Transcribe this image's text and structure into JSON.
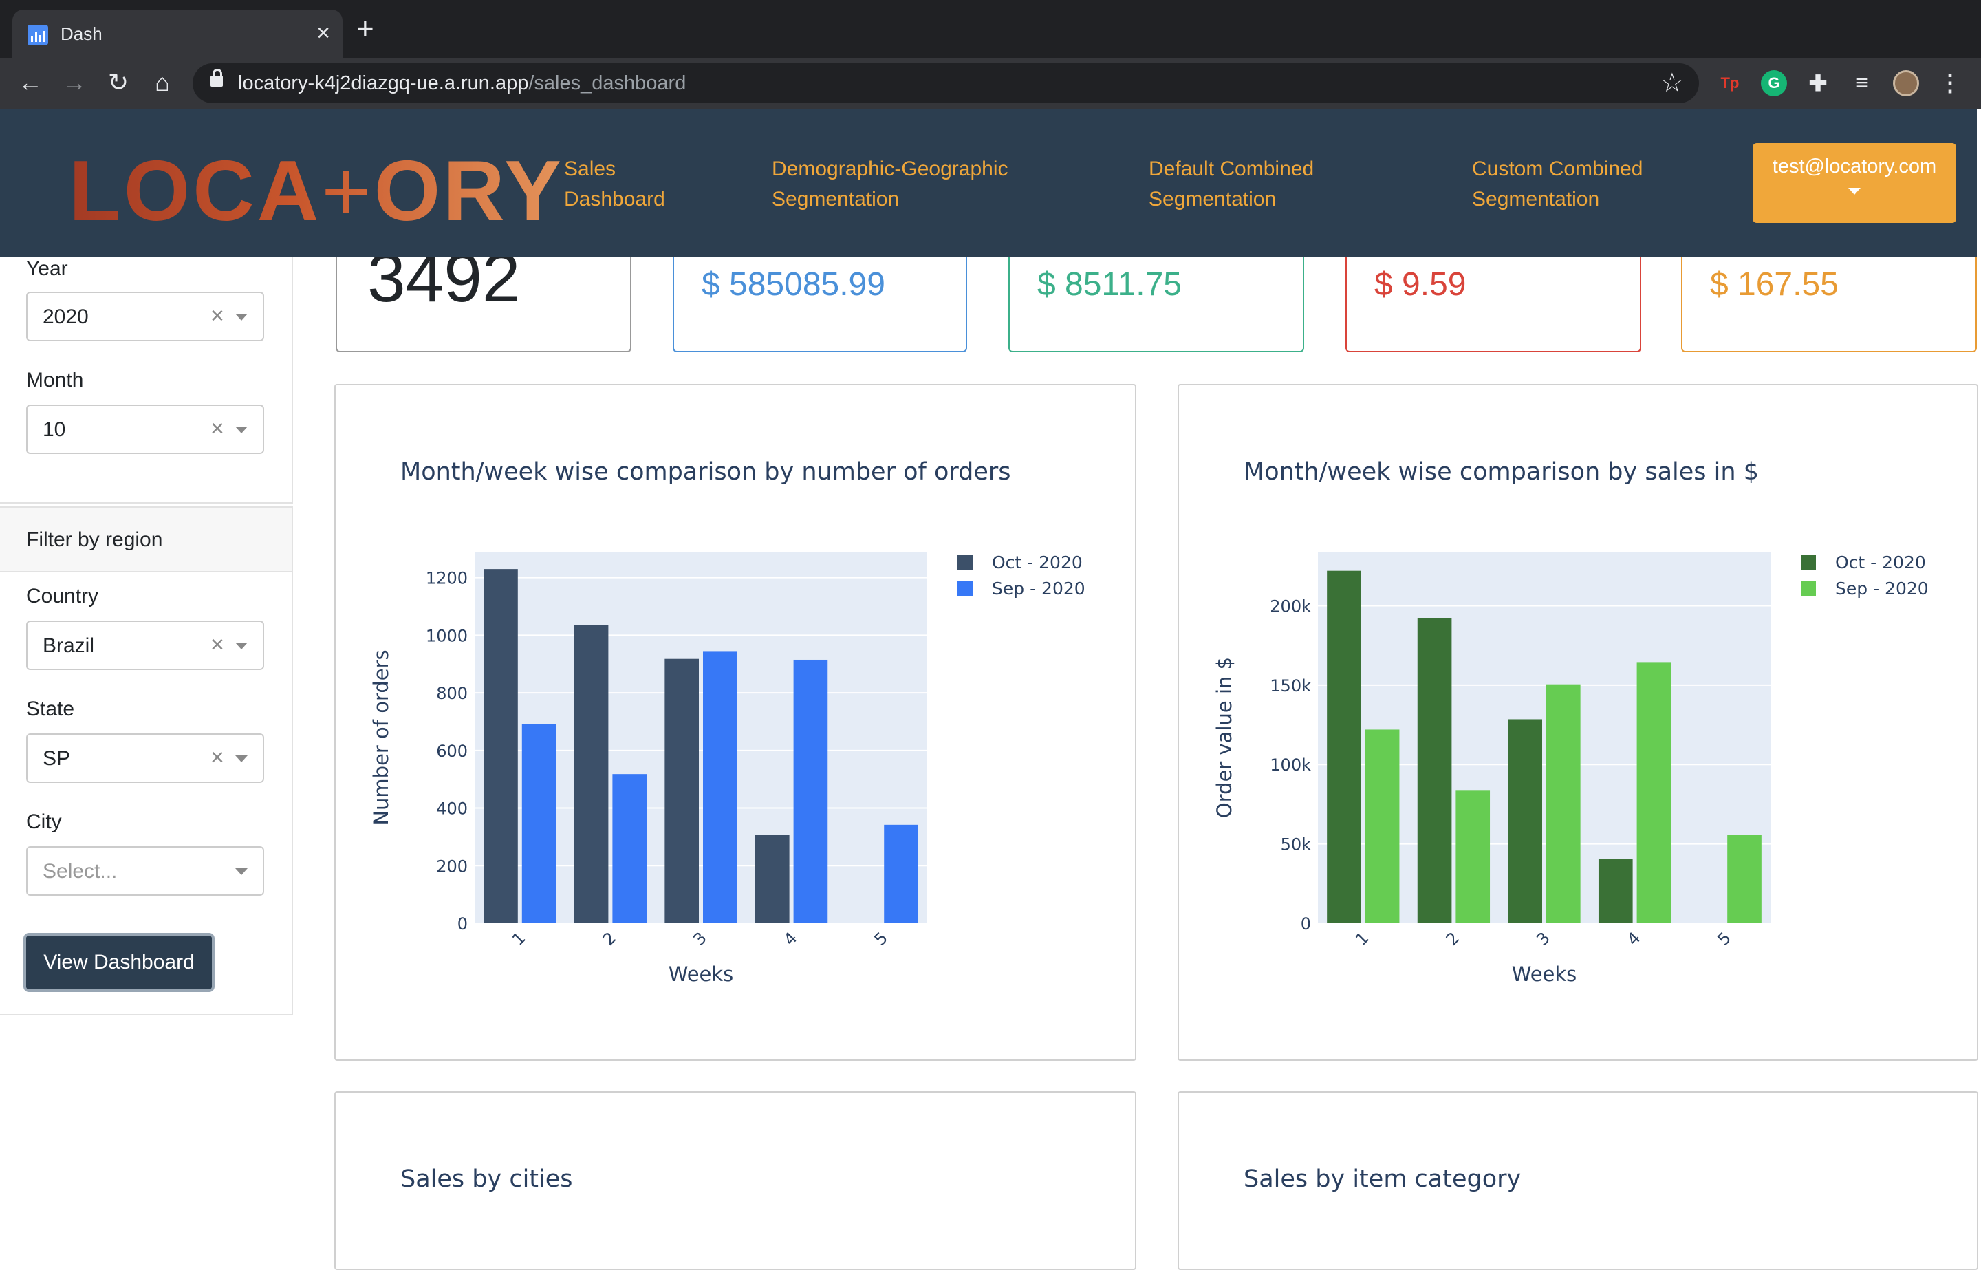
{
  "browser": {
    "tab_title": "Dash",
    "url_host": "locatory-k4j2diazgq-ue.a.run.app",
    "url_path": "/sales_dashboard"
  },
  "header": {
    "logo_text": "LOCATORY",
    "nav": [
      {
        "line1": "Sales",
        "line2": "Dashboard"
      },
      {
        "line1": "Demographic-Geographic",
        "line2": "Segmentation"
      },
      {
        "line1": "Default Combined",
        "line2": "Segmentation"
      },
      {
        "line1": "Custom Combined",
        "line2": "Segmentation"
      }
    ],
    "user_email": "test@locatory.com"
  },
  "sidebar": {
    "year_label": "Year",
    "year_value": "2020",
    "month_label": "Month",
    "month_value": "10",
    "region_header": "Filter by region",
    "country_label": "Country",
    "country_value": "Brazil",
    "state_label": "State",
    "state_value": "SP",
    "city_label": "City",
    "city_placeholder": "Select...",
    "view_button": "View Dashboard"
  },
  "stats": [
    {
      "value": "3492",
      "color": "#212529"
    },
    {
      "value": "$ 585085.99",
      "color": "#4a90d9"
    },
    {
      "value": "$ 8511.75",
      "color": "#3cb08a"
    },
    {
      "value": "$ 9.59",
      "color": "#d9443a"
    },
    {
      "value": "$ 167.55",
      "color": "#e89b34"
    }
  ],
  "cards": {
    "cities_title": "Sales by cities",
    "category_title": "Sales by item category"
  },
  "chart_data": [
    {
      "type": "bar",
      "title": "Month/week wise comparison by number of orders",
      "xlabel": "Weeks",
      "ylabel": "Number of orders",
      "categories": [
        "1",
        "2",
        "3",
        "4",
        "5"
      ],
      "ylim": [
        0,
        1290
      ],
      "yticks": [
        0,
        200,
        400,
        600,
        800,
        1000,
        1200
      ],
      "ytick_labels": [
        "0",
        "200",
        "400",
        "600",
        "800",
        "1000",
        "1200"
      ],
      "grid": true,
      "legend_position": "top-right",
      "series": [
        {
          "name": "Oct - 2020",
          "color": "#3c5069",
          "values": [
            1230,
            1035,
            918,
            308,
            0
          ]
        },
        {
          "name": "Sep - 2020",
          "color": "#3778f6",
          "values": [
            692,
            518,
            945,
            915,
            342
          ]
        }
      ]
    },
    {
      "type": "bar",
      "title": "Month/week wise comparison by sales in $",
      "xlabel": "Weeks",
      "ylabel": "Order value in $",
      "categories": [
        "1",
        "2",
        "3",
        "4",
        "5"
      ],
      "ylim": [
        0,
        234000
      ],
      "yticks": [
        0,
        50000,
        100000,
        150000,
        200000
      ],
      "ytick_labels": [
        "0",
        "50k",
        "100k",
        "150k",
        "200k"
      ],
      "grid": true,
      "legend_position": "top-right",
      "series": [
        {
          "name": "Oct - 2020",
          "color": "#3a7136",
          "values": [
            222000,
            192000,
            128500,
            40500,
            0
          ]
        },
        {
          "name": "Sep - 2020",
          "color": "#66cc52",
          "values": [
            122000,
            83500,
            150500,
            164500,
            55500
          ]
        }
      ]
    }
  ]
}
